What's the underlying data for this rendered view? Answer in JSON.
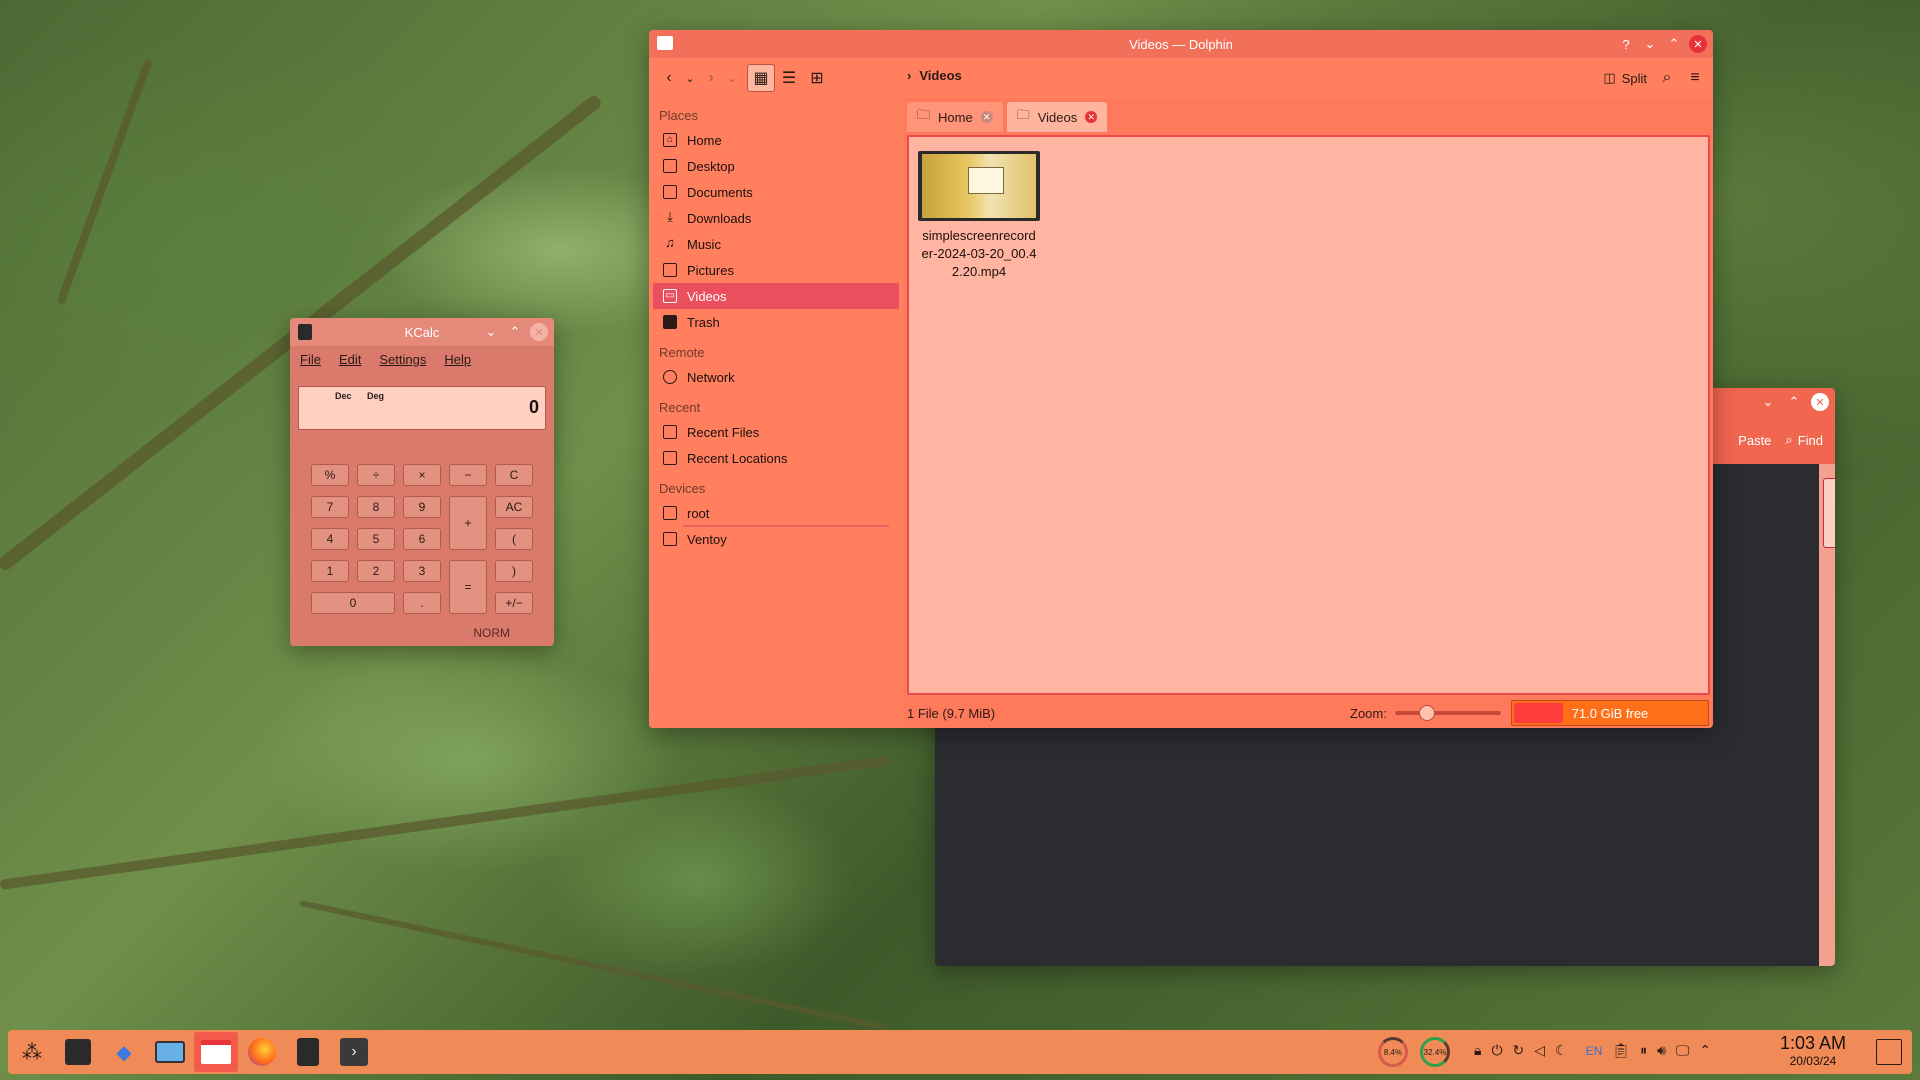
{
  "dolphin": {
    "title": "Videos — Dolphin",
    "breadcrumb": "Videos",
    "split_label": "Split",
    "sidebar": {
      "places_header": "Places",
      "places": [
        "Home",
        "Desktop",
        "Documents",
        "Downloads",
        "Music",
        "Pictures",
        "Videos",
        "Trash"
      ],
      "remote_header": "Remote",
      "remote": [
        "Network"
      ],
      "recent_header": "Recent",
      "recent": [
        "Recent Files",
        "Recent Locations"
      ],
      "devices_header": "Devices",
      "devices": [
        "root",
        "Ventoy"
      ],
      "selected": "Videos"
    },
    "tabs": [
      "Home",
      "Videos"
    ],
    "active_tab": "Videos",
    "file_name": "simplescreenrecorder-2024-03-20_00.42.20.mp4",
    "status_text": "1 File (9.7 MiB)",
    "zoom_label": "Zoom:",
    "zoom_level": 0.3,
    "free_space": "71.0 GiB free",
    "used_fraction": 0.25
  },
  "bgwin": {
    "paste_label": "Paste",
    "find_label": "Find"
  },
  "kcalc": {
    "title": "KCalc",
    "menu": [
      "File",
      "Edit",
      "Settings",
      "Help"
    ],
    "indicator_base": "Dec",
    "indicator_angle": "Deg",
    "display_value": "0",
    "mode_label": "NORM",
    "keys": {
      "percent": "%",
      "divide": "÷",
      "multiply": "×",
      "minus": "−",
      "clear": "C",
      "seven": "7",
      "eight": "8",
      "nine": "9",
      "plus": "+",
      "all_clear": "AC",
      "four": "4",
      "five": "5",
      "six": "6",
      "paren_open": "(",
      "one": "1",
      "two": "2",
      "three": "3",
      "equals": "=",
      "paren_close": ")",
      "zero": "0",
      "dot": ".",
      "plus_minus": "+/−"
    }
  },
  "taskbar": {
    "cpu_gauge": "8.4%",
    "mem_gauge": "32.4%",
    "keyboard_layout": "EN",
    "time": "1:03 AM",
    "date": "20/03/24"
  },
  "colors": {
    "accent": "#f2705a",
    "selection": "#e94f5c",
    "content_bg": "#ffb5a2"
  }
}
